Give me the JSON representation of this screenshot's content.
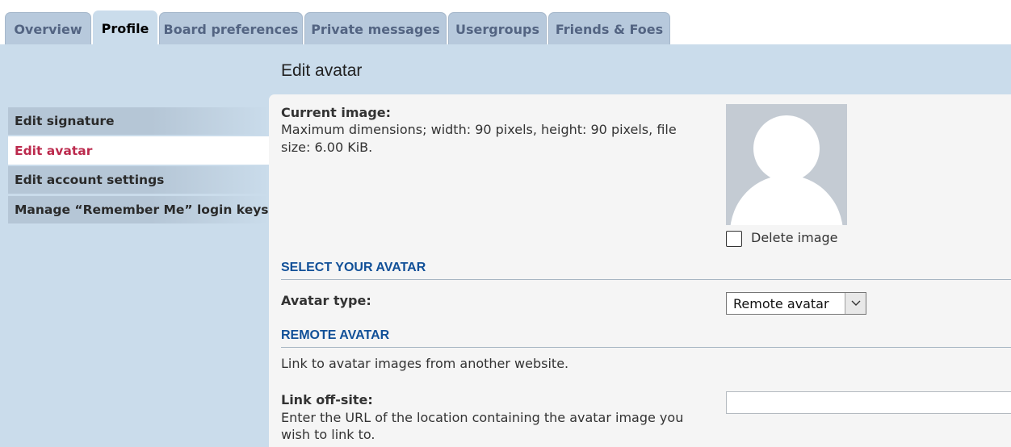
{
  "tabs": [
    {
      "label": "Overview"
    },
    {
      "label": "Profile"
    },
    {
      "label": "Board preferences"
    },
    {
      "label": "Private messages"
    },
    {
      "label": "Usergroups"
    },
    {
      "label": "Friends & Foes"
    }
  ],
  "sidebar": {
    "items": [
      {
        "label": "Edit signature"
      },
      {
        "label": "Edit avatar"
      },
      {
        "label": "Edit account settings"
      },
      {
        "label": "Manage “Remember Me” login keys"
      }
    ]
  },
  "page_title": "Edit avatar",
  "current_image": {
    "label": "Current image:",
    "desc_line1": "Maximum dimensions; width: 90 pixels, height: 90 pixels, file",
    "desc_line2": "size: 6.00 KiB.",
    "delete_label": "Delete image"
  },
  "select_section": {
    "heading": "SELECT YOUR AVATAR",
    "avatar_type_label": "Avatar type:",
    "avatar_type_value": "Remote avatar"
  },
  "remote_section": {
    "heading": "REMOTE AVATAR",
    "description": "Link to avatar images from another website.",
    "link_label": "Link off-site:",
    "link_help_line1": "Enter the URL of the location containing the avatar image you",
    "link_help_line2": "wish to link to.",
    "link_value": ""
  },
  "colors": {
    "panel_bg": "#cadceb",
    "active_link": "#bc2a4d",
    "section_heading": "#115098"
  }
}
